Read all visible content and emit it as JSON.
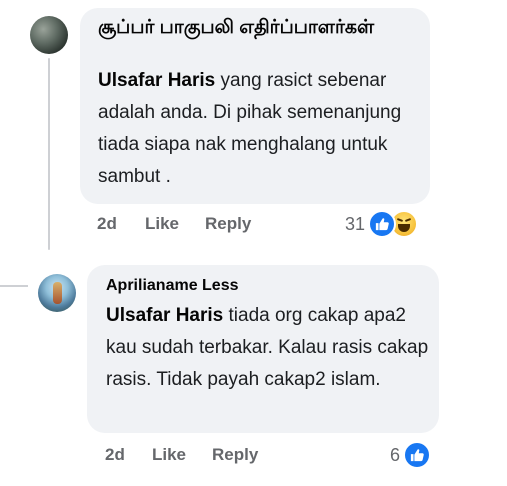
{
  "comment1": {
    "author": "சூப்பர் பாகுபலி எதிர்ப்பாளர்கள்",
    "mention": "Ulsafar Haris",
    "text": " yang rasict sebenar adalah anda. Di pihak semenanjung tiada siapa nak menghalang untuk sambut .",
    "time": "2d",
    "like_label": "Like",
    "reply_label": "Reply",
    "reaction_count": "31",
    "reactions": [
      "like-icon",
      "haha-icon"
    ]
  },
  "comment2": {
    "author": "Aprilianame Less",
    "mention": "Ulsafar Haris",
    "text": " tiada org cakap apa2 kau sudah terbakar. Kalau rasis cakap rasis. Tidak payah cakap2 islam.",
    "time": "2d",
    "like_label": "Like",
    "reply_label": "Reply",
    "reaction_count": "6",
    "reactions": [
      "like-icon"
    ]
  },
  "colors": {
    "bubble": "#f0f2f5",
    "action_text": "#65676b",
    "like_blue": "#1877f2",
    "thread_line": "#ced0d4"
  }
}
